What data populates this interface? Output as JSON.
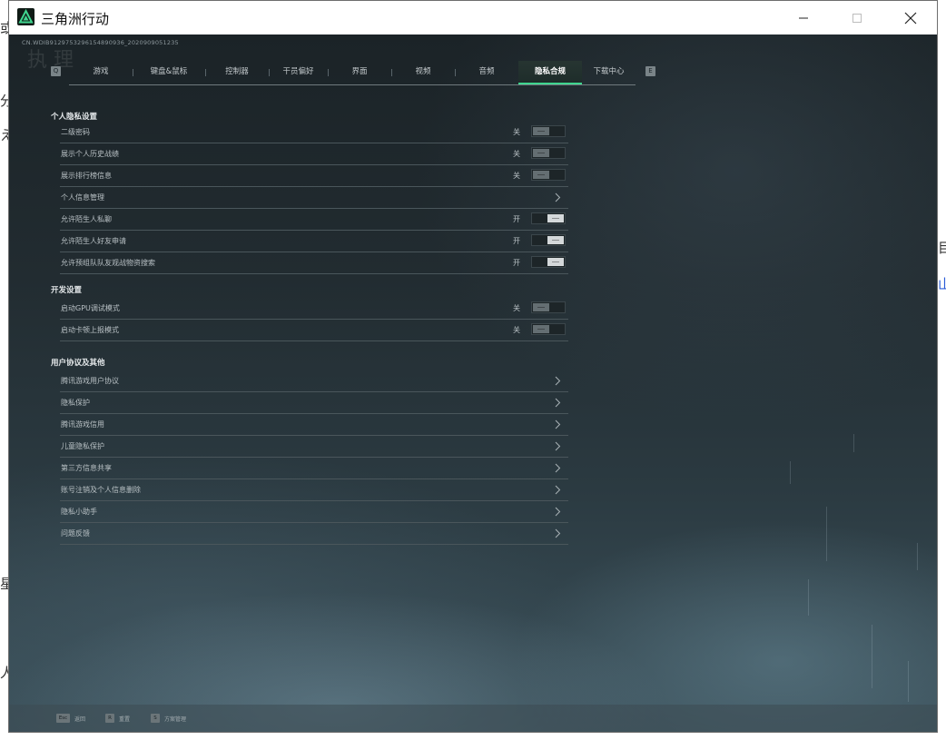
{
  "window": {
    "title": "三角洲行动",
    "accent": "#3fd68f"
  },
  "desktop_peek": {
    "left": [
      "或",
      "分",
      "え",
      "星",
      "人"
    ],
    "right": [
      "目",
      "山"
    ]
  },
  "header": {
    "version": "CN.WDIB9129753296154890936_2020909051235",
    "ghost": "执 理"
  },
  "tabs": {
    "left_key": "Q",
    "right_key": "E",
    "items": [
      {
        "label": "游戏"
      },
      {
        "label": "键盘&鼠标"
      },
      {
        "label": "控制器"
      },
      {
        "label": "干员偏好"
      },
      {
        "label": "界面"
      },
      {
        "label": "视频"
      },
      {
        "label": "音频"
      },
      {
        "label": "隐私合规",
        "active": true
      },
      {
        "label": "下载中心"
      }
    ]
  },
  "sections": [
    {
      "title": "个人隐私设置",
      "rows": [
        {
          "label": "二级密码",
          "type": "toggle",
          "state": "关",
          "on": false
        },
        {
          "label": "展示个人历史战绩",
          "type": "toggle",
          "state": "关",
          "on": false
        },
        {
          "label": "展示排行榜信息",
          "type": "toggle",
          "state": "关",
          "on": false
        },
        {
          "label": "个人信息管理",
          "type": "link"
        },
        {
          "label": "允许陌生人私聊",
          "type": "toggle",
          "state": "开",
          "on": true
        },
        {
          "label": "允许陌生人好友申请",
          "type": "toggle",
          "state": "开",
          "on": true
        },
        {
          "label": "允许预组队队友观战物资搜索",
          "type": "toggle",
          "state": "开",
          "on": true
        }
      ]
    },
    {
      "title": "开发设置",
      "rows": [
        {
          "label": "启动GPU调试模式",
          "type": "toggle",
          "state": "关",
          "on": false
        },
        {
          "label": "启动卡顿上报模式",
          "type": "toggle",
          "state": "关",
          "on": false
        }
      ]
    },
    {
      "title": "用户协议及其他",
      "rows": [
        {
          "label": "腾讯游戏用户协议",
          "type": "link"
        },
        {
          "label": "隐私保护",
          "type": "link"
        },
        {
          "label": "腾讯游戏信用",
          "type": "link"
        },
        {
          "label": "儿童隐私保护",
          "type": "link"
        },
        {
          "label": "第三方信息共享",
          "type": "link"
        },
        {
          "label": "账号注销及个人信息删除",
          "type": "link"
        },
        {
          "label": "隐私小助手",
          "type": "link"
        },
        {
          "label": "问题反馈",
          "type": "link"
        }
      ]
    }
  ],
  "hints": [
    {
      "key": "Esc",
      "label": "返回"
    },
    {
      "key": "R",
      "label": "重置"
    },
    {
      "key": "S",
      "label": "方案管理"
    }
  ]
}
